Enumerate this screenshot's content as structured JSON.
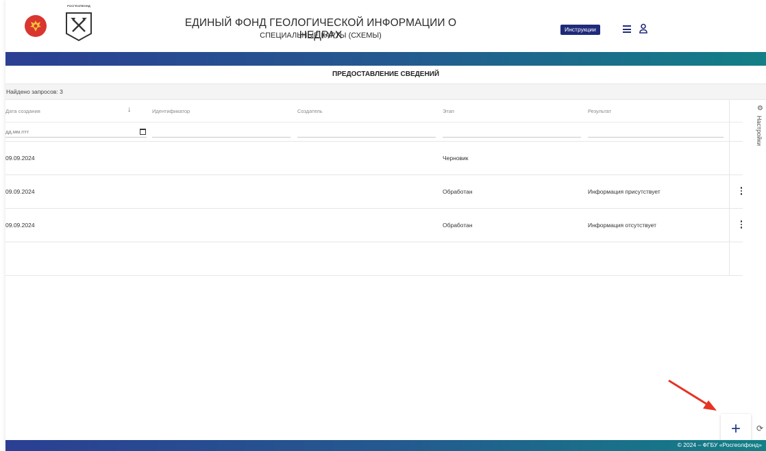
{
  "header": {
    "logo_caption": "РОСГЕОЛФОНД",
    "title": "ЕДИНЫЙ ФОНД ГЕОЛОГИЧЕСКОЙ ИНФОРМАЦИИ О НЕДРАХ",
    "subtitle": "СПЕЦИАЛЬНЫЕ КАРТЫ (СХЕМЫ)",
    "instructions_label": "Инструкции",
    "menu_icon": "hamburger-menu-icon",
    "user_icon": "user-icon",
    "accent_color": "#1f2a7a"
  },
  "section": {
    "title": "ПРЕДОСТАВЛЕНИЕ СВЕДЕНИЙ",
    "found_text": "Найдено запросов: 3"
  },
  "table": {
    "columns": [
      "Дата создания",
      "Идентификатор",
      "Создатель",
      "Этап",
      "Результат"
    ],
    "date_placeholder": "дд.мм.гггг",
    "rows": [
      {
        "date": "09.09.2024",
        "stage": "Черновик",
        "result": ""
      },
      {
        "date": "09.09.2024",
        "stage": "Обработан",
        "result": "Информация присутствует"
      },
      {
        "date": "09.09.2024",
        "stage": "Обработан",
        "result": "Информация отсутствует"
      }
    ]
  },
  "side": {
    "settings_label": "Настройки"
  },
  "fab": {
    "label": "+"
  },
  "footer": {
    "text": "© 2024 – ФГБУ «Росгеолфонд»"
  }
}
